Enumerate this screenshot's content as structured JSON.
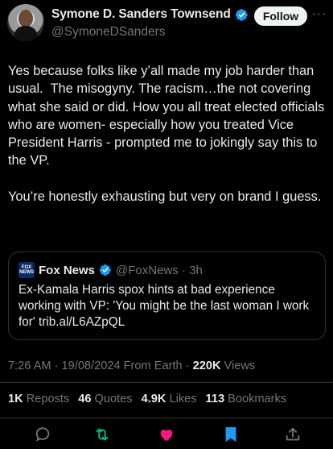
{
  "author": {
    "display_name": "Symone D. Sanders Townsend",
    "handle": "@SymoneDSanders",
    "verified": true
  },
  "header": {
    "follow_label": "Follow",
    "more_icon": "more-horizontal-icon"
  },
  "tweet": {
    "text": "Yes because folks like y’all made my job harder than usual.  The misogyny. The racism…the not covering what she said or did. How you all treat elected officials who are women- especially how you treated Vice President Harris - prompted me to jokingly say this to the VP.\n\nYou’re honestly exhausting but very on brand I guess."
  },
  "quote": {
    "logo_text_1": "FOX",
    "logo_text_2": "NEWS",
    "name": "Fox News",
    "handle_time": "@FoxNews · 3h",
    "text": "Ex-Kamala Harris spox hints at bad experience working with VP: 'You might be the last woman I work for' trib.al/L6AZpQL"
  },
  "meta": {
    "time": "7:26 AM",
    "sep1": " · ",
    "date": "19/08/2024",
    "source": " From Earth",
    "sep2": " · ",
    "views_count": "220K",
    "views_label": " Views"
  },
  "stats": {
    "reposts_count": "1K",
    "reposts_label": " Reposts",
    "quotes_count": "46",
    "quotes_label": " Quotes",
    "likes_count": "4.9K",
    "likes_label": " Likes",
    "bookmarks_count": "113",
    "bookmarks_label": " Bookmarks"
  },
  "colors": {
    "background": "#000000",
    "text": "#e7e9ea",
    "muted": "#71767b",
    "verified_blue": "#1d9bf0",
    "repost_green": "#00ba7c",
    "like_pink": "#f91880",
    "bookmark_blue": "#1d9bf0"
  },
  "actions": [
    "reply-icon",
    "repost-icon",
    "like-icon",
    "bookmark-icon",
    "share-icon"
  ]
}
